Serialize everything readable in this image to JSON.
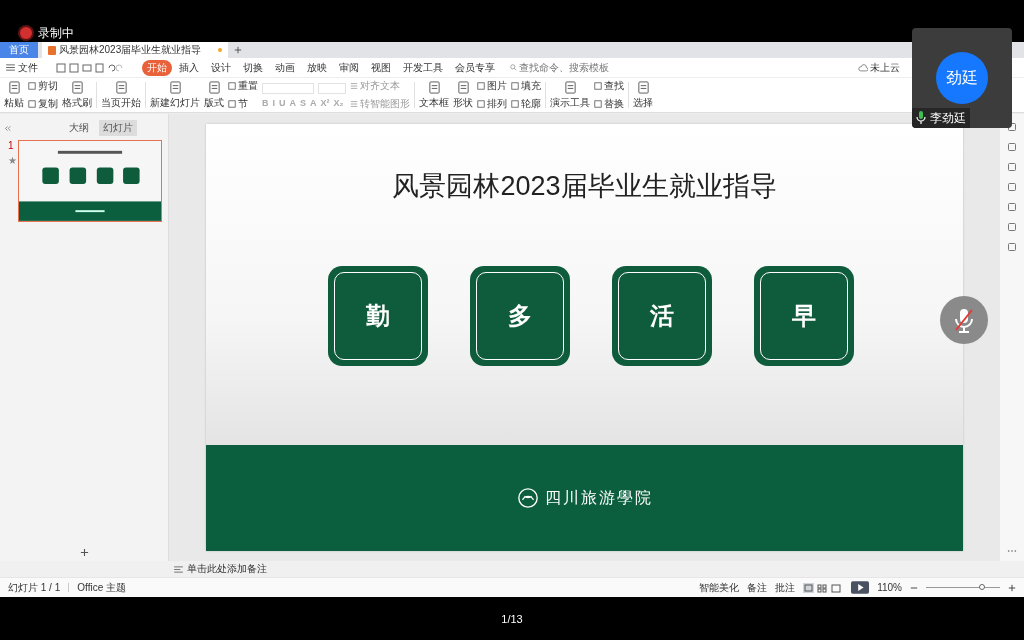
{
  "recording": {
    "label": "录制中"
  },
  "tabs": [
    {
      "label": "首页",
      "kind": "home",
      "selected": false
    },
    {
      "label": "风景园林2023届毕业生就业指导",
      "kind": "doc",
      "selected": true
    }
  ],
  "file_menu": "文件",
  "menu": [
    {
      "label": "开始",
      "selected": true
    },
    {
      "label": "插入",
      "selected": false
    },
    {
      "label": "设计",
      "selected": false
    },
    {
      "label": "切换",
      "selected": false
    },
    {
      "label": "动画",
      "selected": false
    },
    {
      "label": "放映",
      "selected": false
    },
    {
      "label": "审阅",
      "selected": false
    },
    {
      "label": "视图",
      "selected": false
    },
    {
      "label": "开发工具",
      "selected": false
    },
    {
      "label": "会员专享",
      "selected": false
    }
  ],
  "search": {
    "placeholder": "查找命令、搜索模板"
  },
  "cloud_status": "未上云",
  "toolbar": [
    {
      "kind": "large",
      "label": "粘贴"
    },
    {
      "kind": "pair",
      "items": [
        "剪切",
        "复制"
      ]
    },
    {
      "kind": "large",
      "label": "格式刷"
    },
    {
      "kind": "sep"
    },
    {
      "kind": "large",
      "label": "当页开始"
    },
    {
      "kind": "sep"
    },
    {
      "kind": "large",
      "label": "新建幻灯片"
    },
    {
      "kind": "large",
      "label": "版式"
    },
    {
      "kind": "pair",
      "items": [
        "重置",
        "节"
      ]
    },
    {
      "kind": "font",
      "letters": [
        "B",
        "I",
        "U",
        "A",
        "S",
        "A",
        "X²",
        "X₂"
      ]
    },
    {
      "kind": "para",
      "items": [
        "对齐文本",
        "转智能图形"
      ]
    },
    {
      "kind": "sep"
    },
    {
      "kind": "large",
      "label": "文本框"
    },
    {
      "kind": "large",
      "label": "形状"
    },
    {
      "kind": "pair",
      "items": [
        "图片",
        "排列"
      ]
    },
    {
      "kind": "pair",
      "items": [
        "填充",
        "轮廓"
      ]
    },
    {
      "kind": "sep"
    },
    {
      "kind": "large",
      "label": "演示工具"
    },
    {
      "kind": "pair",
      "items": [
        "查找",
        "替换"
      ]
    },
    {
      "kind": "sep"
    },
    {
      "kind": "large",
      "label": "选择"
    }
  ],
  "panel_tabs": [
    {
      "label": "大纲",
      "selected": false
    },
    {
      "label": "幻灯片",
      "selected": true
    }
  ],
  "slides": [
    {
      "number": "1",
      "mark": "★",
      "selected": true
    }
  ],
  "slide": {
    "title": "风景园林2023届毕业生就业指导",
    "cards": [
      "勤",
      "多",
      "活",
      "早"
    ],
    "footer": "四川旅游學院"
  },
  "notes": {
    "placeholder": "单击此处添加备注"
  },
  "status": {
    "slide": "幻灯片 1 / 1",
    "theme": "Office 主题",
    "beautify": "智能美化",
    "notes": "备注",
    "comments": "批注",
    "zoom": "110%",
    "zoom_slider": {
      "level": 0.75
    }
  },
  "video": {
    "initials": "劲廷",
    "name": "李劲廷"
  },
  "page_counter": "1/13"
}
